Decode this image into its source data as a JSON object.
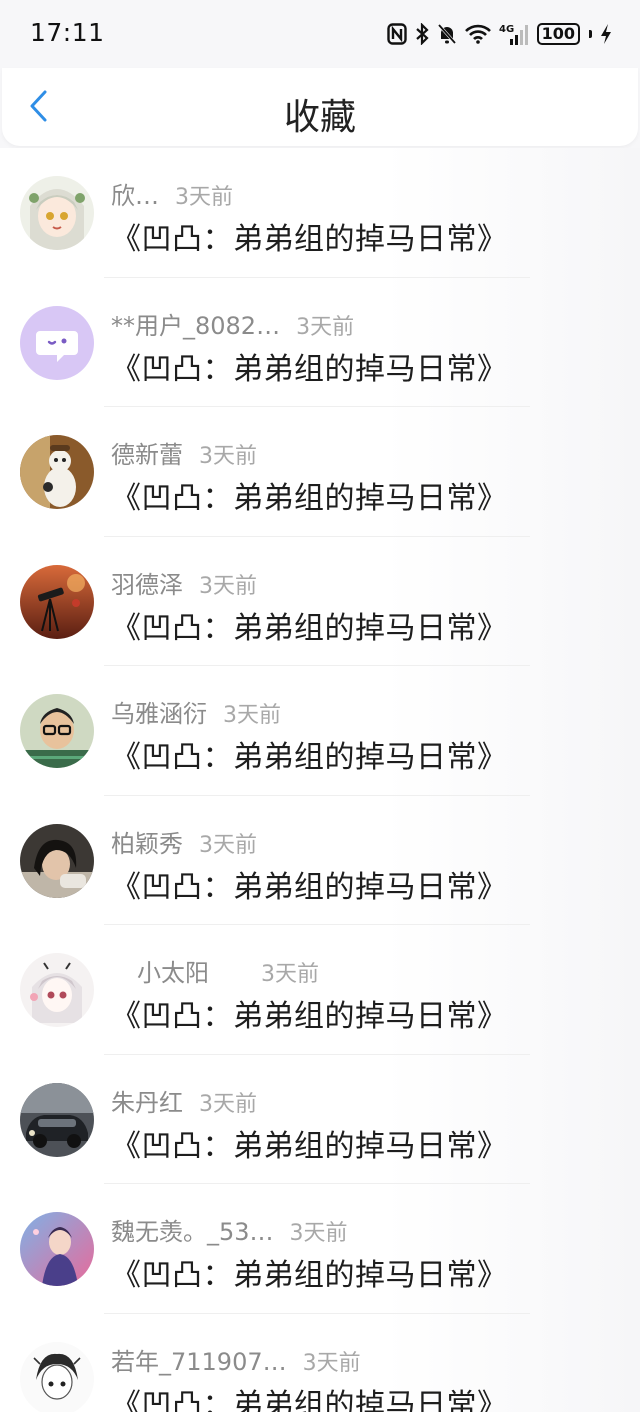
{
  "status_bar": {
    "time": "17:11",
    "icons": [
      "nfc-icon",
      "bluetooth-icon",
      "bell-off-icon",
      "wifi-icon",
      "signal-4g-icon",
      "battery-icon",
      "charging-icon"
    ],
    "network": "4G",
    "battery": "100"
  },
  "header": {
    "title": "收藏",
    "back_icon": "chevron-left-icon",
    "accent_color": "#2f8ee6"
  },
  "items": [
    {
      "name": "欣…",
      "time": "3天前",
      "title": "《凹凸：弟弟组的掉马日常》",
      "avatar_icon": "anime-girl-avatar"
    },
    {
      "name": "**用户_8082…",
      "time": "3天前",
      "title": "《凹凸：弟弟组的掉马日常》",
      "avatar_icon": "default-chat-avatar"
    },
    {
      "name": "德新蕾",
      "time": "3天前",
      "title": "《凹凸：弟弟组的掉马日常》",
      "avatar_icon": "cartoon-avatar"
    },
    {
      "name": "羽德泽",
      "time": "3天前",
      "title": "《凹凸：弟弟组的掉马日常》",
      "avatar_icon": "camera-avatar"
    },
    {
      "name": "乌雅涵衍",
      "time": "3天前",
      "title": "《凹凸：弟弟组的掉马日常》",
      "avatar_icon": "person-glasses-avatar"
    },
    {
      "name": "柏颖秀",
      "time": "3天前",
      "title": "《凹凸：弟弟组的掉马日常》",
      "avatar_icon": "person-avatar"
    },
    {
      "name": "小太阳",
      "time": "3天前",
      "title": "《凹凸：弟弟组的掉马日常》",
      "avatar_icon": "anime-sketch-avatar"
    },
    {
      "name": "朱丹红",
      "time": "3天前",
      "title": "《凹凸：弟弟组的掉马日常》",
      "avatar_icon": "car-avatar"
    },
    {
      "name": "魏无羡。_53…",
      "time": "3天前",
      "title": "《凹凸：弟弟组的掉马日常》",
      "avatar_icon": "anime-boy-avatar"
    },
    {
      "name": "若年_711907…",
      "time": "3天前",
      "title": "《凹凸：弟弟组的掉马日常》",
      "avatar_icon": "anime-sketch-avatar"
    }
  ]
}
